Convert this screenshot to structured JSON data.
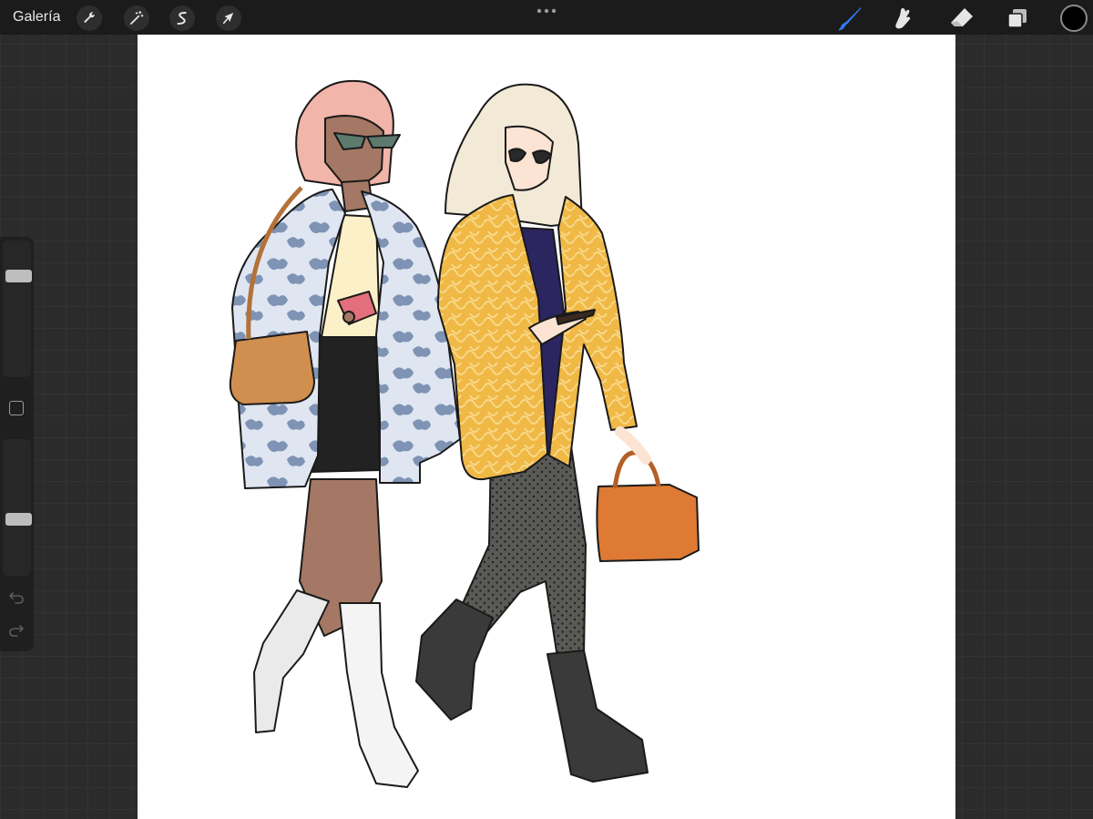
{
  "toolbar": {
    "gallery_label": "Galería",
    "left_tools": [
      "wrench-icon",
      "magic-wand-icon",
      "selection-icon",
      "transform-arrow-icon"
    ],
    "right_tools": [
      "brush-icon",
      "smudge-icon",
      "eraser-icon",
      "layers-icon"
    ],
    "active_tool": "brush-icon",
    "accent_color": "#2f7cf6",
    "current_color": "#000000"
  },
  "sidebar": {
    "brush_size": 0.78,
    "opacity": 0.4,
    "icons": [
      "modify-square-icon",
      "undo-icon",
      "redo-icon"
    ]
  },
  "canvas": {
    "background": "#ffffff",
    "artwork": "fashion-illustration-two-women-walking"
  }
}
